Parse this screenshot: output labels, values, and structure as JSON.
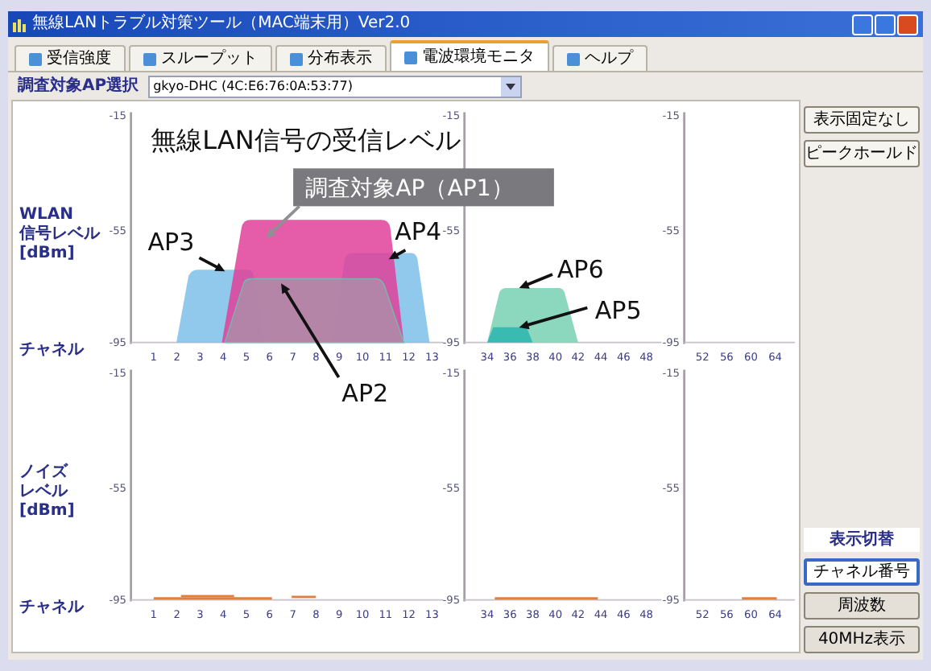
{
  "window": {
    "title": "無線LANトラブル対策ツール（MAC端末用）Ver2.0"
  },
  "tabs": [
    {
      "label": "受信強度",
      "selected": false
    },
    {
      "label": "スループット",
      "selected": false
    },
    {
      "label": "分布表示",
      "selected": false
    },
    {
      "label": "電波環境モニタ",
      "selected": true
    },
    {
      "label": "ヘルプ",
      "selected": false
    }
  ],
  "ap_selector": {
    "label": "調査対象AP選択",
    "value": "gkyo-DHC (4C:E6:76:0A:53:77)"
  },
  "signal_chart": {
    "ylabel": [
      "WLAN",
      "信号レベル",
      "[dBm]"
    ],
    "channel_label": "チャネル",
    "panels": [
      {
        "yticks": [
          "-15",
          "-55",
          "-95"
        ],
        "channels": [
          "1",
          "2",
          "3",
          "4",
          "5",
          "6",
          "7",
          "8",
          "9",
          "10",
          "11",
          "12",
          "13"
        ]
      },
      {
        "yticks": [
          "-15",
          "-55",
          "-95"
        ],
        "channels": [
          "34",
          "36",
          "38",
          "40",
          "42",
          "44",
          "46",
          "48"
        ]
      },
      {
        "yticks": [
          "-15",
          "-55",
          "-95"
        ],
        "channels": [
          "52",
          "56",
          "60",
          "64"
        ]
      }
    ]
  },
  "noise_chart": {
    "ylabel": [
      "ノイズ",
      "レベル",
      "[dBm]"
    ],
    "channel_label": "チャネル",
    "panels": [
      {
        "yticks": [
          "-15",
          "-55",
          "-95"
        ],
        "channels": [
          "1",
          "2",
          "3",
          "4",
          "5",
          "6",
          "7",
          "8",
          "9",
          "10",
          "11",
          "12",
          "13"
        ]
      },
      {
        "yticks": [
          "-15",
          "-55",
          "-95"
        ],
        "channels": [
          "34",
          "36",
          "38",
          "40",
          "42",
          "44",
          "46",
          "48"
        ]
      },
      {
        "yticks": [
          "-15",
          "-55",
          "-95"
        ],
        "channels": [
          "52",
          "56",
          "60",
          "64"
        ]
      }
    ]
  },
  "side_buttons": [
    "表示固定なし",
    "ピークホールド"
  ],
  "display_switch": {
    "label": "表示切替",
    "buttons": [
      {
        "label": "チャネル番号",
        "selected": true
      },
      {
        "label": "周波数",
        "selected": false
      },
      {
        "label": "40MHz表示",
        "selected": false
      }
    ]
  },
  "annotations": {
    "title": "無線LAN信号の受信レベル",
    "target": "調査対象AP（AP1）",
    "ap_labels": [
      "AP3",
      "AP4",
      "AP2",
      "AP6",
      "AP5"
    ]
  }
}
